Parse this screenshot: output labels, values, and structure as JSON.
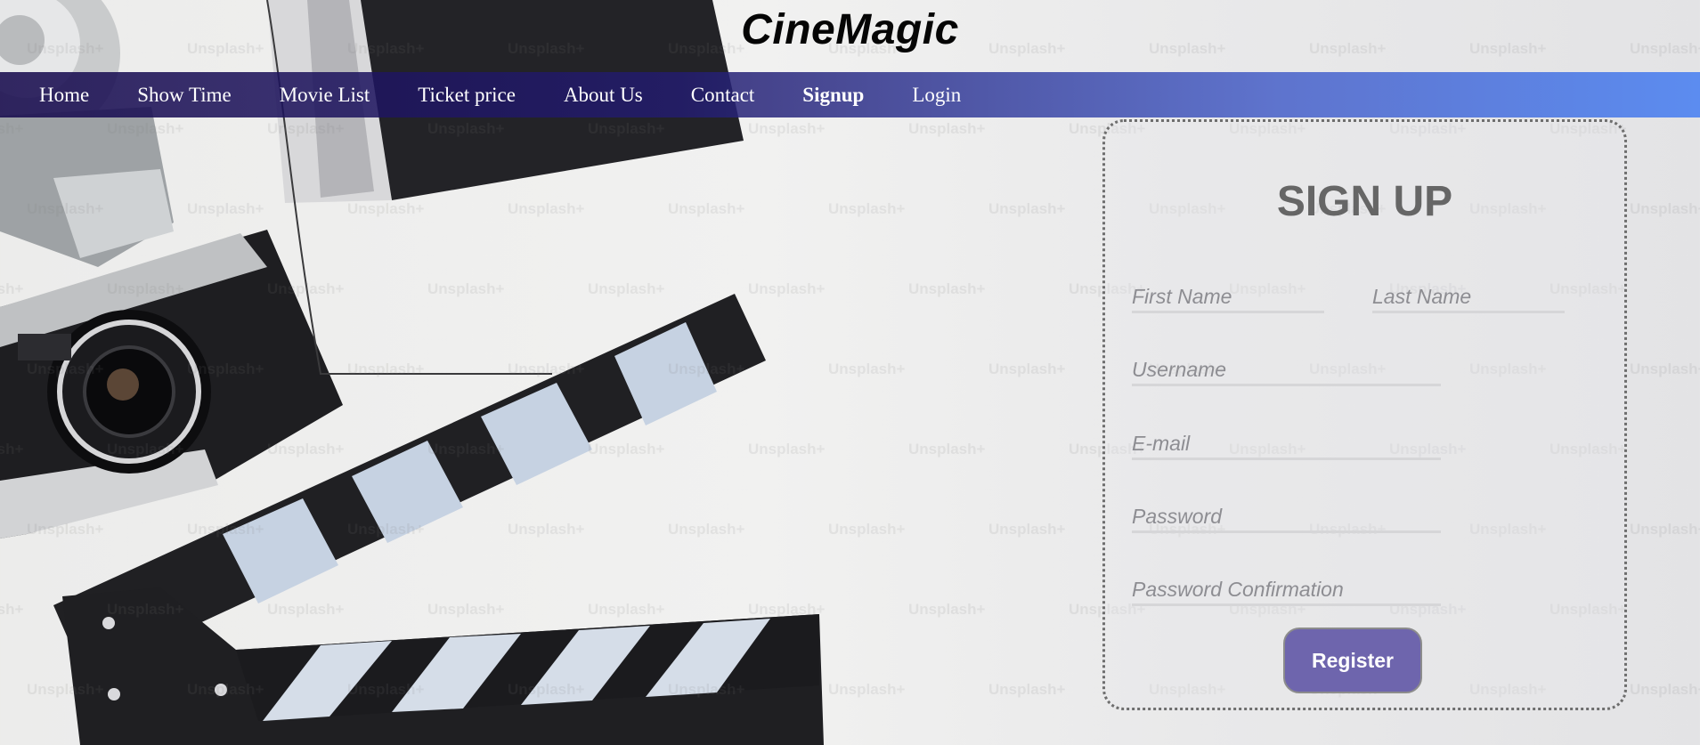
{
  "site": {
    "title": "CineMagic"
  },
  "nav": {
    "items": [
      {
        "label": "Home"
      },
      {
        "label": "Show Time"
      },
      {
        "label": "Movie List"
      },
      {
        "label": "Ticket price"
      },
      {
        "label": "About Us"
      },
      {
        "label": "Contact"
      },
      {
        "label": "Signup",
        "active": true
      },
      {
        "label": "Login"
      }
    ]
  },
  "signup": {
    "title": "SIGN UP",
    "first_name_placeholder": "First Name",
    "last_name_placeholder": "Last Name",
    "username_placeholder": "Username",
    "email_placeholder": "E-mail",
    "password_placeholder": "Password",
    "password_confirm_placeholder": "Password Confirmation",
    "register_label": "Register"
  },
  "background": {
    "watermark": "Unsplash+"
  },
  "colors": {
    "nav_start": "#180c4e",
    "nav_end": "#5c8cf0",
    "register_button": "#6e65ad",
    "title_text": "#666666"
  }
}
